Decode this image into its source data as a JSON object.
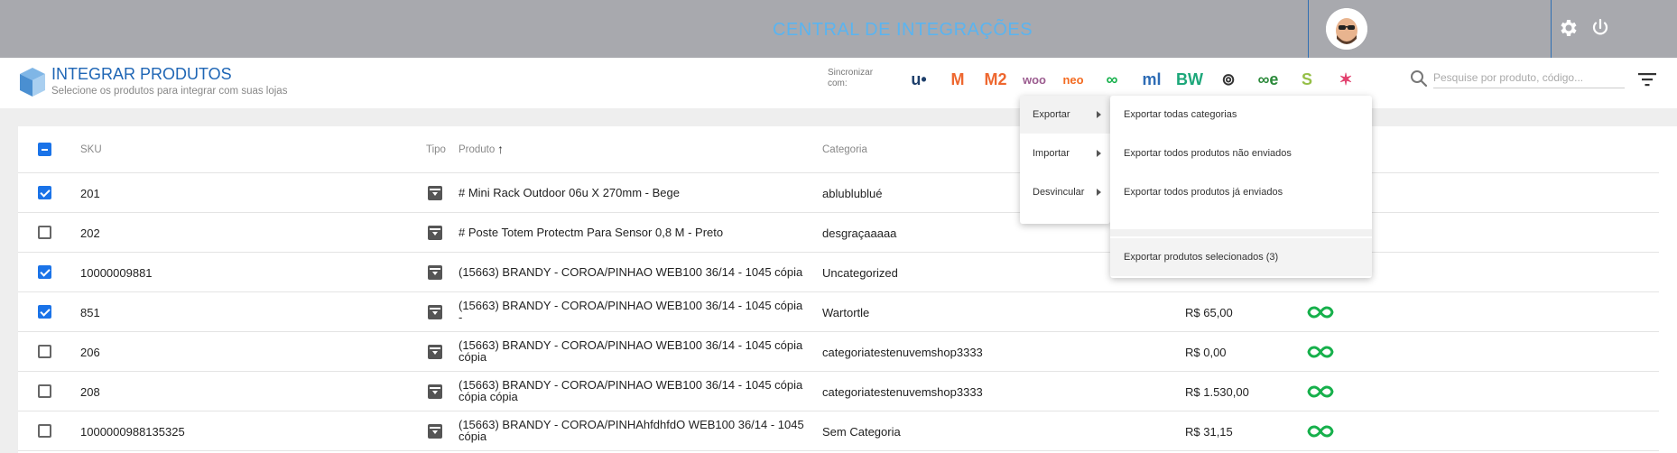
{
  "topbar": {
    "title": "CENTRAL DE INTEGRAÇÕES"
  },
  "header": {
    "title": "INTEGRAR PRODUTOS",
    "subtitle": "Selecione os produtos para integrar com suas lojas",
    "sync_label": "Sincronizar com:",
    "search_placeholder": "Pesquise por produto, código..."
  },
  "integrations": [
    {
      "name": "uoou",
      "text": "u•",
      "color": "#1e3f6b"
    },
    {
      "name": "magento",
      "text": "M",
      "color": "#ee672f"
    },
    {
      "name": "magento2",
      "text": "M2",
      "color": "#ee672f"
    },
    {
      "name": "woocommerce",
      "text": "woo",
      "color": "#9b5c8f"
    },
    {
      "name": "neo",
      "text": "neo",
      "color": "#f36b21"
    },
    {
      "name": "nuvemshop",
      "text": "∞",
      "color": "#16b04b"
    },
    {
      "name": "mercadolivre",
      "text": "ml",
      "color": "#2d6cb5"
    },
    {
      "name": "bw",
      "text": "BW",
      "color": "#1da77a"
    },
    {
      "name": "loja-integrada",
      "text": "⊚",
      "color": "#333333"
    },
    {
      "name": "nuvem-commerce",
      "text": "∞e",
      "color": "#2c8a3b"
    },
    {
      "name": "shopify",
      "text": "S",
      "color": "#95bf47"
    },
    {
      "name": "tray",
      "text": "✶",
      "color": "#e2406e"
    }
  ],
  "table": {
    "headers": {
      "sku": "SKU",
      "tipo": "Tipo",
      "produto": "Produto",
      "sort": "↑",
      "categoria": "Categoria"
    },
    "rows": [
      {
        "checked": true,
        "sku": "201",
        "produto": [
          "# Mini Rack Outdoor 06u X 270mm - Bege"
        ],
        "categoria": "ablublublué",
        "preco": "",
        "infinity": false
      },
      {
        "checked": false,
        "sku": "202",
        "produto": [
          "# Poste Totem Protectm Para Sensor 0,8 M - Preto"
        ],
        "categoria": "desgraçaaaaa",
        "preco": "",
        "infinity": false
      },
      {
        "checked": true,
        "sku": "10000009881",
        "produto": [
          "(15663) BRANDY - COROA/PINHAO WEB100 36/14 - 1045 cópia"
        ],
        "categoria": "Uncategorized",
        "preco": "",
        "infinity": false
      },
      {
        "checked": true,
        "sku": "851",
        "produto": [
          "(15663) BRANDY - COROA/PINHAO WEB100 36/14 - 1045 cópia",
          "-"
        ],
        "categoria": "Wartortle",
        "preco": "R$ 65,00",
        "infinity": true
      },
      {
        "checked": false,
        "sku": "206",
        "produto": [
          "(15663) BRANDY - COROA/PINHAO WEB100 36/14 - 1045 cópia",
          "cópia"
        ],
        "categoria": "categoriatestenuvemshop3333",
        "preco": "R$ 0,00",
        "infinity": true
      },
      {
        "checked": false,
        "sku": "208",
        "produto": [
          "(15663) BRANDY - COROA/PINHAO WEB100 36/14 - 1045 cópia",
          "cópia cópia"
        ],
        "categoria": "categoriatestenuvemshop3333",
        "preco": "R$ 1.530,00",
        "infinity": true
      },
      {
        "checked": false,
        "sku": "1000000988135325",
        "produto": [
          "(15663) BRANDY - COROA/PINHAhfdhfdO WEB100 36/14 - 1045",
          "cópia"
        ],
        "categoria": "Sem Categoria",
        "preco": "R$ 31,15",
        "infinity": true
      }
    ]
  },
  "menu": {
    "items": [
      {
        "label": "Exportar",
        "active": true
      },
      {
        "label": "Importar",
        "active": false
      },
      {
        "label": "Desvincular",
        "active": false
      }
    ]
  },
  "submenu": {
    "items": [
      "Exportar todas categorias",
      "Exportar todos produtos não enviados",
      "Exportar todos produtos já enviados"
    ],
    "selected": "Exportar produtos selecionados (3)"
  },
  "colors": {
    "accent": "#1a73e8",
    "title": "#1f66b5",
    "topbar": "#a8a9ae",
    "green": "#16b04b"
  }
}
